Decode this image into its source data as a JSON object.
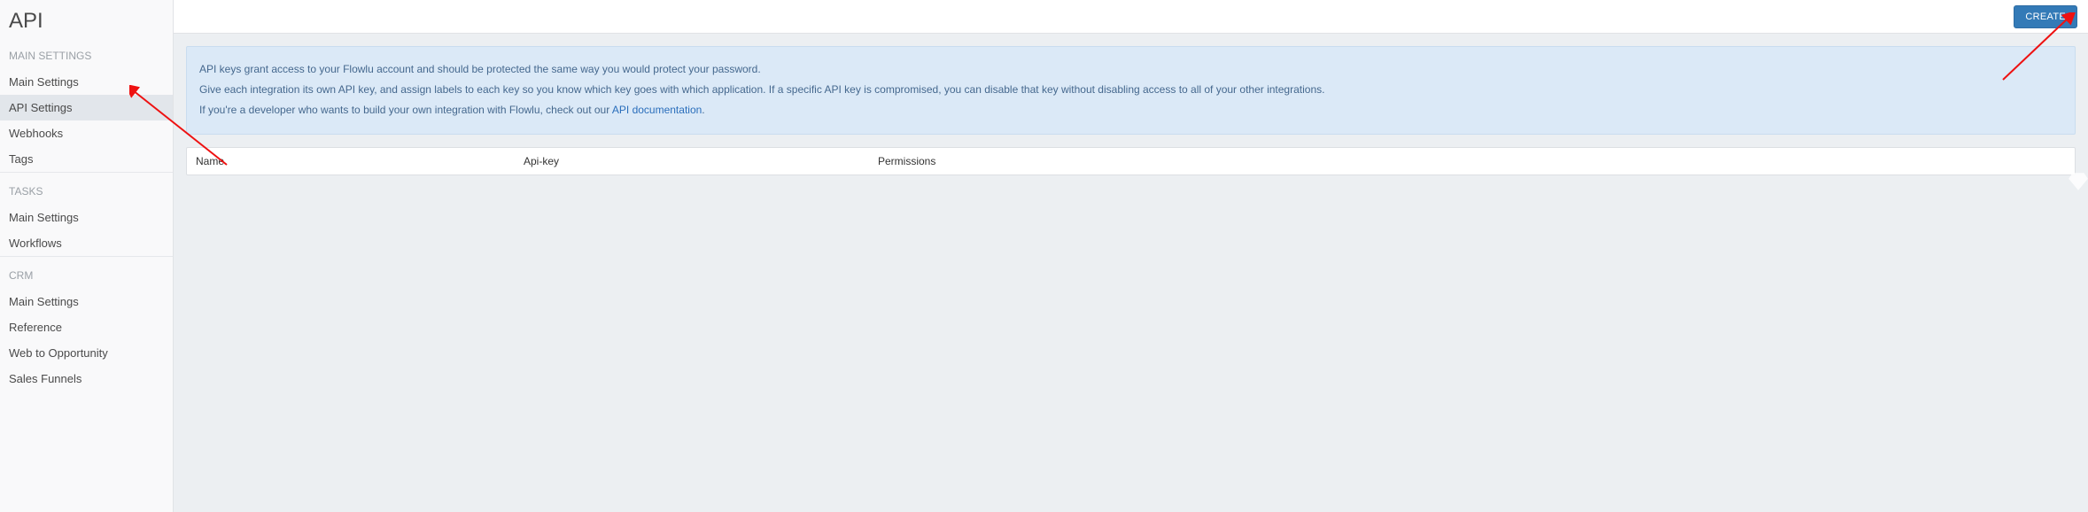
{
  "page_title": "API",
  "create_button": "CREATE",
  "sidebar": {
    "sections": [
      {
        "title": "MAIN SETTINGS",
        "items": [
          {
            "label": "Main Settings",
            "active": false
          },
          {
            "label": "API Settings",
            "active": true
          },
          {
            "label": "Webhooks",
            "active": false
          },
          {
            "label": "Tags",
            "active": false
          }
        ]
      },
      {
        "title": "TASKS",
        "items": [
          {
            "label": "Main Settings",
            "active": false
          },
          {
            "label": "Workflows",
            "active": false
          }
        ]
      },
      {
        "title": "CRM",
        "items": [
          {
            "label": "Main Settings",
            "active": false
          },
          {
            "label": "Reference",
            "active": false
          },
          {
            "label": "Web to Opportunity",
            "active": false
          },
          {
            "label": "Sales Funnels",
            "active": false
          }
        ]
      }
    ]
  },
  "banner": {
    "line1": "API keys grant access to your Flowlu account and should be protected the same way you would protect your password.",
    "line2": "Give each integration its own API key, and assign labels to each key so you know which key goes with which application. If a specific API key is compromised, you can disable that key without disabling access to all of your other integrations.",
    "line3_prefix": "If you're a developer who wants to build your own integration with Flowlu, check out our ",
    "line3_link": "API documentation",
    "line3_suffix": "."
  },
  "table": {
    "columns": {
      "name": "Name",
      "key": "Api-key",
      "permissions": "Permissions"
    }
  }
}
